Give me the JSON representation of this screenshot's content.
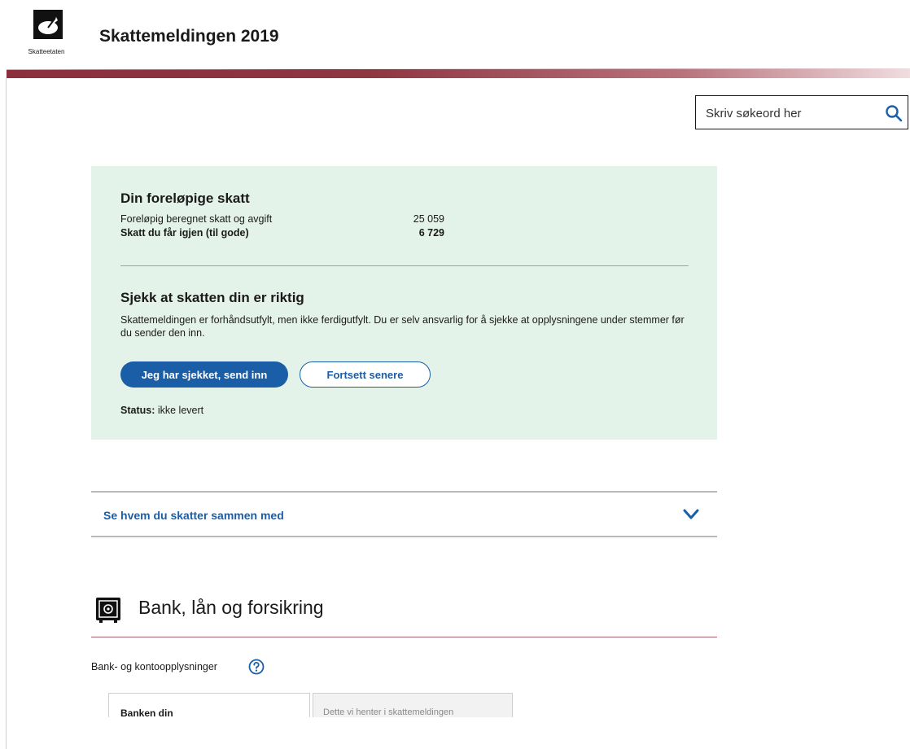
{
  "header": {
    "logo_text": "Skatteetaten",
    "title": "Skattemeldingen 2019"
  },
  "search": {
    "placeholder": "Skriv søkeord her"
  },
  "summary": {
    "title": "Din foreløpige skatt",
    "rows": [
      {
        "label": "Foreløpig beregnet skatt og avgift",
        "value": "25 059"
      },
      {
        "label": "Skatt du får igjen (til gode)",
        "value": "6 729"
      }
    ],
    "check_title": "Sjekk at skatten din er riktig",
    "check_text": "Skattemeldingen er forhåndsutfylt, men ikke ferdigutfylt. Du er selv ansvarlig for å sjekke at opplysningene under stemmer før du sender den inn.",
    "submit_label": "Jeg har sjekket, send inn",
    "later_label": "Fortsett senere",
    "status_label": "Status:",
    "status_value": "ikke levert"
  },
  "accordion": {
    "label": "Se hvem du skatter sammen med"
  },
  "bank": {
    "title": "Bank, lån og forsikring",
    "field_label": "Bank- og kontoopplysninger",
    "card_a_text": "Banken din",
    "card_b_text": "Dette vi henter i skattemeldingen"
  },
  "colors": {
    "brand_red": "#8b2f3c",
    "primary_blue": "#1a5ea8",
    "panel_green": "#e4f3ea"
  }
}
